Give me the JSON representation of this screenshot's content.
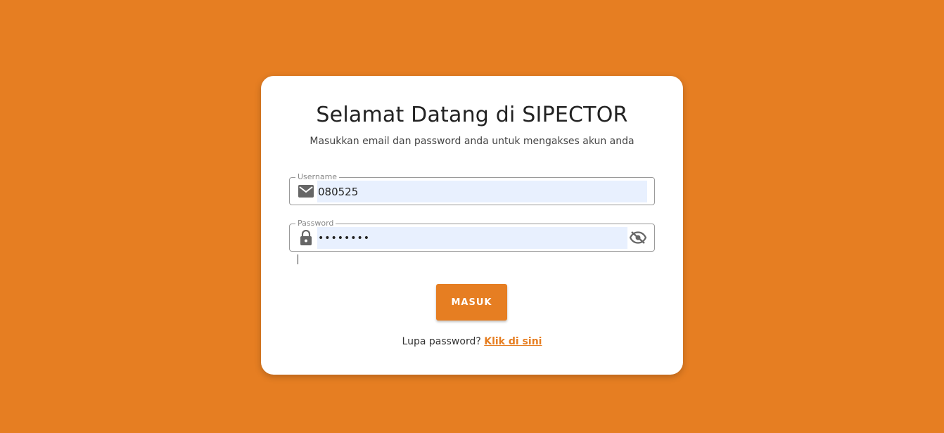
{
  "colors": {
    "background": "#E67E22",
    "accent": "#E67E22",
    "card": "#ffffff",
    "autofill": "#E8F0FE"
  },
  "login": {
    "title": "Selamat Datang di SIPECTOR",
    "subtitle": "Masukkan email dan password anda untuk mengakses akun anda",
    "username": {
      "label": "Username",
      "value": "080525",
      "icon": "email-icon"
    },
    "password": {
      "label": "Password",
      "value": "••••••••",
      "icon": "lock-icon",
      "toggle_icon": "eye-off-icon"
    },
    "submit_label": "MASUK",
    "forgot_text": "Lupa password?",
    "forgot_link": "Klik di sini"
  }
}
